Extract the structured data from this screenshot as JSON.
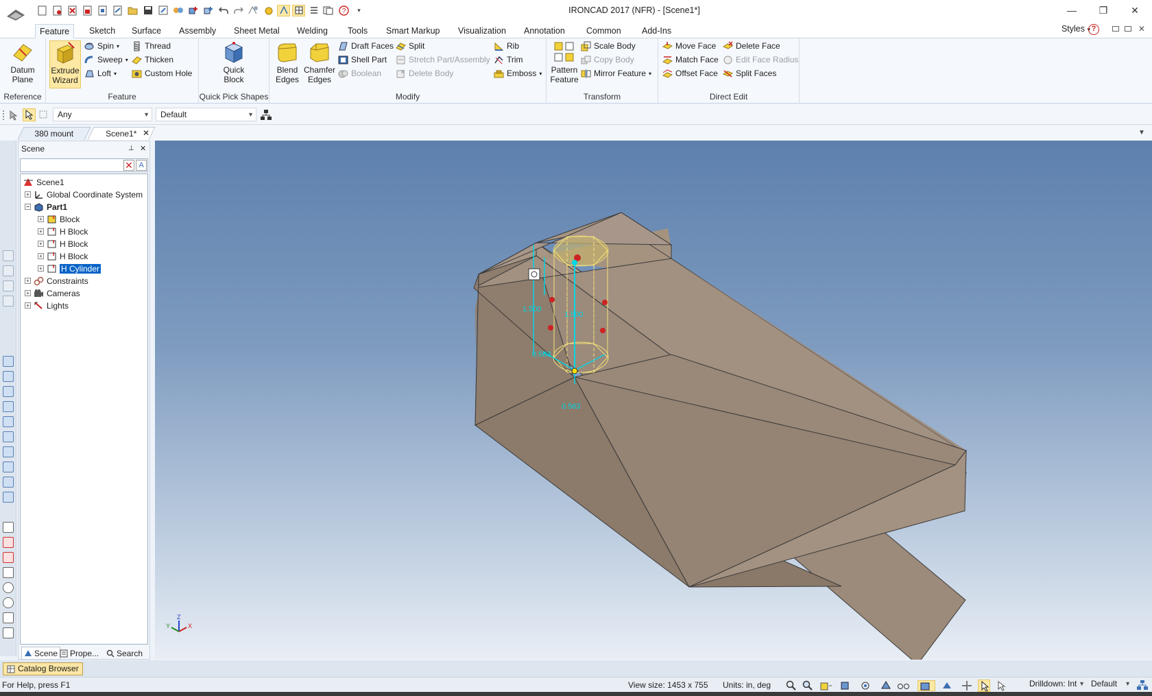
{
  "window": {
    "title": "IRONCAD 2017 (NFR) - [Scene1*]",
    "minimize": "—",
    "maximize": "❐",
    "close": "✕"
  },
  "ribbon_tabs": [
    "Feature",
    "Sketch",
    "Surface",
    "Assembly",
    "Sheet Metal",
    "Welding",
    "Tools",
    "Smart Markup",
    "Visualization",
    "Annotation",
    "Common",
    "Add-Ins"
  ],
  "styles_label": "Styles",
  "groups": {
    "reference": {
      "label": "Reference",
      "datum_plane": "Datum\nPlane"
    },
    "feature": {
      "label": "Feature",
      "extrude_wizard": "Extrude\nWizard",
      "spin": "Spin",
      "sweep": "Sweep",
      "loft": "Loft",
      "thread": "Thread",
      "thicken": "Thicken",
      "custom_hole": "Custom Hole"
    },
    "quick_pick": {
      "label": "Quick Pick Shapes",
      "quick_block": "Quick\nBlock"
    },
    "modify": {
      "label": "Modify",
      "blend_edges": "Blend\nEdges",
      "chamfer_edges": "Chamfer\nEdges",
      "draft_faces": "Draft Faces",
      "shell_part": "Shell Part",
      "boolean": "Boolean",
      "split": "Split",
      "stretch": "Stretch Part/Assembly",
      "delete_body": "Delete Body",
      "rib": "Rib",
      "trim": "Trim",
      "emboss": "Emboss"
    },
    "transform": {
      "label": "Transform",
      "pattern_feature": "Pattern\nFeature",
      "scale_body": "Scale Body",
      "copy_body": "Copy Body",
      "mirror_feature": "Mirror Feature"
    },
    "direct_edit": {
      "label": "Direct Edit",
      "move_face": "Move Face",
      "match_face": "Match Face",
      "offset_face": "Offset Face",
      "delete_face": "Delete Face",
      "edit_face_radius": "Edit Face Radius",
      "split_faces": "Split Faces"
    }
  },
  "selection_filter": {
    "value": "Any"
  },
  "selection_scheme": {
    "value": "Default"
  },
  "doc_tabs": [
    "380 mount",
    "Scene1*"
  ],
  "scene_panel": {
    "title": "Scene",
    "tree": [
      "Scene1",
      "Global Coordinate System",
      "Part1",
      "Block",
      "H Block",
      "H Block",
      "H Block",
      "H Cylinder",
      "Constraints",
      "Cameras",
      "Lights"
    ],
    "bottom_tabs": [
      "Scene",
      "Prope...",
      "Search"
    ]
  },
  "viewport": {
    "dimensions": [
      "1.500",
      "1.500",
      "0.563",
      "0.563"
    ],
    "axes": {
      "x": "X",
      "y": "Y",
      "z": "Z"
    }
  },
  "catalog_browser": "Catalog Browser",
  "status": {
    "help": "For Help, press F1",
    "view_size": "View size: 1453 x  755",
    "units": "Units: in, deg",
    "drilldown": "Drilldown: Int",
    "default": "Default"
  },
  "colors": {
    "accent": "#0a64c8",
    "part": "#a79484",
    "handle": "#00d6e6",
    "highlight": "#fde9a4"
  }
}
